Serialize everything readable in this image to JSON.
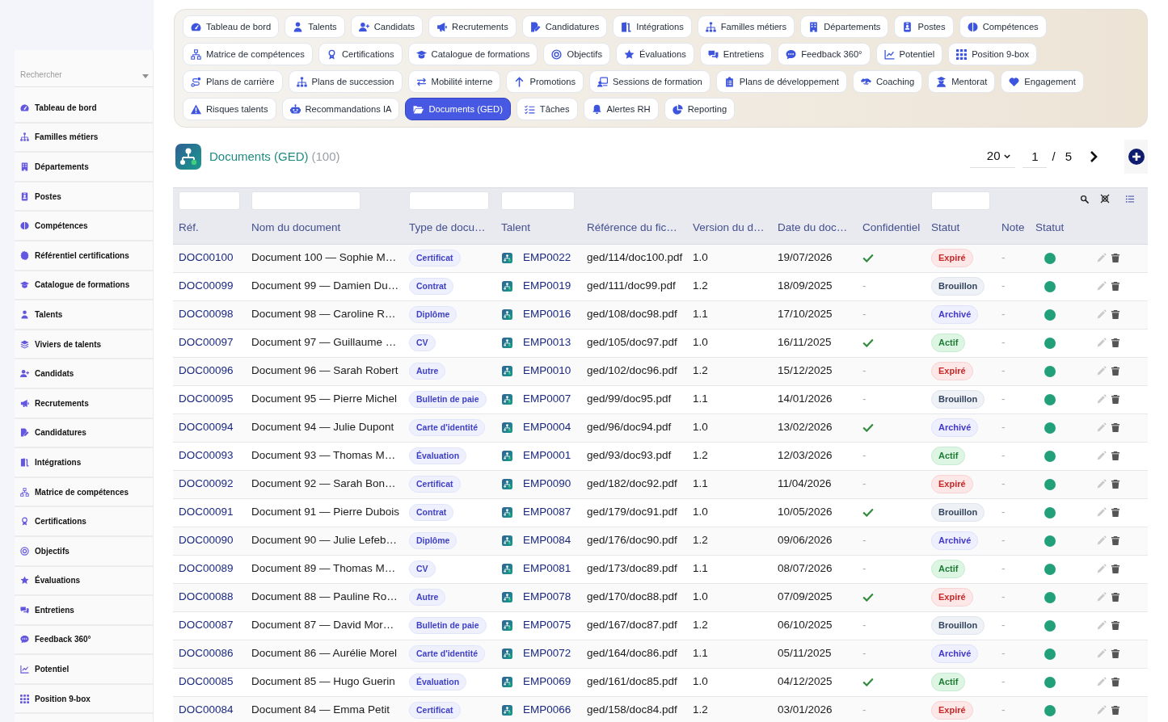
{
  "sidebar": {
    "search": {
      "placeholder": "Rechercher"
    },
    "items": [
      {
        "label": "Tableau de bord"
      },
      {
        "label": "Familles métiers"
      },
      {
        "label": "Départements"
      },
      {
        "label": "Postes"
      },
      {
        "label": "Compétences"
      },
      {
        "label": "Référentiel certifications"
      },
      {
        "label": "Catalogue de formations"
      },
      {
        "label": "Talents"
      },
      {
        "label": "Viviers de talents"
      },
      {
        "label": "Candidats"
      },
      {
        "label": "Recrutements"
      },
      {
        "label": "Candidatures"
      },
      {
        "label": "Intégrations"
      },
      {
        "label": "Matrice de compétences"
      },
      {
        "label": "Certifications"
      },
      {
        "label": "Objectifs"
      },
      {
        "label": "Évaluations"
      },
      {
        "label": "Entretiens"
      },
      {
        "label": "Feedback 360°"
      },
      {
        "label": "Potentiel"
      },
      {
        "label": "Position 9-box"
      }
    ]
  },
  "nav_tabs": [
    {
      "label": "Tableau de bord",
      "selected": false
    },
    {
      "label": "Talents",
      "selected": false
    },
    {
      "label": "Candidats",
      "selected": false
    },
    {
      "label": "Recrutements",
      "selected": false
    },
    {
      "label": "Candidatures",
      "selected": false
    },
    {
      "label": "Intégrations",
      "selected": false
    },
    {
      "label": "Familles métiers",
      "selected": false
    },
    {
      "label": "Départements",
      "selected": false
    },
    {
      "label": "Postes",
      "selected": false
    },
    {
      "label": "Compétences",
      "selected": false
    },
    {
      "label": "Matrice de compétences",
      "selected": false
    },
    {
      "label": "Certifications",
      "selected": false
    },
    {
      "label": "Catalogue de formations",
      "selected": false
    },
    {
      "label": "Objectifs",
      "selected": false
    },
    {
      "label": "Évaluations",
      "selected": false
    },
    {
      "label": "Entretiens",
      "selected": false
    },
    {
      "label": "Feedback 360°",
      "selected": false
    },
    {
      "label": "Potentiel",
      "selected": false
    },
    {
      "label": "Position 9-box",
      "selected": false
    },
    {
      "label": "Plans de carrière",
      "selected": false
    },
    {
      "label": "Plans de succession",
      "selected": false
    },
    {
      "label": "Mobilité interne",
      "selected": false
    },
    {
      "label": "Promotions",
      "selected": false
    },
    {
      "label": "Sessions de formation",
      "selected": false
    },
    {
      "label": "Plans de développement",
      "selected": false
    },
    {
      "label": "Coaching",
      "selected": false
    },
    {
      "label": "Mentorat",
      "selected": false
    },
    {
      "label": "Engagement",
      "selected": false
    },
    {
      "label": "Risques talents",
      "selected": false
    },
    {
      "label": "Recommandations IA",
      "selected": false
    },
    {
      "label": "Documents (GED)",
      "selected": true
    },
    {
      "label": "Tâches",
      "selected": false
    },
    {
      "label": "Alertes RH",
      "selected": false
    },
    {
      "label": "Reporting",
      "selected": false
    }
  ],
  "header": {
    "title": "Documents (GED)",
    "count": "(100)",
    "page_size": "20",
    "page": "1",
    "page_separator": "/",
    "page_count": "5"
  },
  "table": {
    "columns": [
      {
        "label": "Réf.",
        "filter": true
      },
      {
        "label": "Nom du document",
        "filter": true
      },
      {
        "label": "Type de docu…",
        "filter": true
      },
      {
        "label": "Talent",
        "filter": true
      },
      {
        "label": "Référence du fic…",
        "filter": false
      },
      {
        "label": "Version du d…",
        "filter": false
      },
      {
        "label": "Date du doc…",
        "filter": false
      },
      {
        "label": "Confidentiel",
        "filter": false
      },
      {
        "label": "Statut",
        "filter": true
      },
      {
        "label": "Note",
        "filter": false
      },
      {
        "label": "Statut",
        "filter": false
      }
    ],
    "rows": [
      {
        "ref": "DOC00100",
        "name": "Document 100 — Sophie M…",
        "type": "Certificat",
        "talent": "EMP0022",
        "file": "ged/114/doc100.pdf",
        "version": "1.0",
        "date": "19/07/2026",
        "confidential": true,
        "status": {
          "label": "Expiré",
          "kind": "expired"
        },
        "note": "-",
        "active": true
      },
      {
        "ref": "DOC00099",
        "name": "Document 99 — Damien Du…",
        "type": "Contrat",
        "talent": "EMP0019",
        "file": "ged/111/doc99.pdf",
        "version": "1.2",
        "date": "18/09/2025",
        "confidential": false,
        "confidential_text": "-",
        "status": {
          "label": "Brouillon",
          "kind": "draft"
        },
        "note": "-",
        "active": true
      },
      {
        "ref": "DOC00098",
        "name": "Document 98 — Caroline R…",
        "type": "Diplôme",
        "talent": "EMP0016",
        "file": "ged/108/doc98.pdf",
        "version": "1.1",
        "date": "17/10/2025",
        "confidential": false,
        "confidential_text": "-",
        "status": {
          "label": "Archivé",
          "kind": "archived"
        },
        "note": "-",
        "active": true
      },
      {
        "ref": "DOC00097",
        "name": "Document 97 — Guillaume …",
        "type": "CV",
        "talent": "EMP0013",
        "file": "ged/105/doc97.pdf",
        "version": "1.0",
        "date": "16/11/2025",
        "confidential": true,
        "status": {
          "label": "Actif",
          "kind": "active"
        },
        "note": "-",
        "active": true
      },
      {
        "ref": "DOC00096",
        "name": "Document 96 — Sarah Robert",
        "type": "Autre",
        "talent": "EMP0010",
        "file": "ged/102/doc96.pdf",
        "version": "1.2",
        "date": "15/12/2025",
        "confidential": false,
        "confidential_text": "-",
        "status": {
          "label": "Expiré",
          "kind": "expired"
        },
        "note": "-",
        "active": true
      },
      {
        "ref": "DOC00095",
        "name": "Document 95 — Pierre Michel",
        "type": "Bulletin de paie",
        "talent": "EMP0007",
        "file": "ged/99/doc95.pdf",
        "version": "1.1",
        "date": "14/01/2026",
        "confidential": false,
        "confidential_text": "-",
        "status": {
          "label": "Brouillon",
          "kind": "draft"
        },
        "note": "-",
        "active": true
      },
      {
        "ref": "DOC00094",
        "name": "Document 94 — Julie Dupont",
        "type": "Carte d'identité",
        "talent": "EMP0004",
        "file": "ged/96/doc94.pdf",
        "version": "1.0",
        "date": "13/02/2026",
        "confidential": true,
        "status": {
          "label": "Archivé",
          "kind": "archived"
        },
        "note": "-",
        "active": true
      },
      {
        "ref": "DOC00093",
        "name": "Document 93 — Thomas M…",
        "type": "Évaluation",
        "talent": "EMP0001",
        "file": "ged/93/doc93.pdf",
        "version": "1.2",
        "date": "12/03/2026",
        "confidential": false,
        "confidential_text": "-",
        "status": {
          "label": "Actif",
          "kind": "active"
        },
        "note": "-",
        "active": true
      },
      {
        "ref": "DOC00092",
        "name": "Document 92 — Sarah Bon…",
        "type": "Certificat",
        "talent": "EMP0090",
        "file": "ged/182/doc92.pdf",
        "version": "1.1",
        "date": "11/04/2026",
        "confidential": false,
        "confidential_text": "-",
        "status": {
          "label": "Expiré",
          "kind": "expired"
        },
        "note": "-",
        "active": true
      },
      {
        "ref": "DOC00091",
        "name": "Document 91 — Pierre Dubois",
        "type": "Contrat",
        "talent": "EMP0087",
        "file": "ged/179/doc91.pdf",
        "version": "1.0",
        "date": "10/05/2026",
        "confidential": true,
        "status": {
          "label": "Brouillon",
          "kind": "draft"
        },
        "note": "-",
        "active": true
      },
      {
        "ref": "DOC00090",
        "name": "Document 90 — Julie Lefeb…",
        "type": "Diplôme",
        "talent": "EMP0084",
        "file": "ged/176/doc90.pdf",
        "version": "1.2",
        "date": "09/06/2026",
        "confidential": false,
        "confidential_text": "-",
        "status": {
          "label": "Archivé",
          "kind": "archived"
        },
        "note": "-",
        "active": true
      },
      {
        "ref": "DOC00089",
        "name": "Document 89 — Thomas M…",
        "type": "CV",
        "talent": "EMP0081",
        "file": "ged/173/doc89.pdf",
        "version": "1.1",
        "date": "08/07/2026",
        "confidential": false,
        "confidential_text": "-",
        "status": {
          "label": "Actif",
          "kind": "active"
        },
        "note": "-",
        "active": true
      },
      {
        "ref": "DOC00088",
        "name": "Document 88 — Pauline Ro…",
        "type": "Autre",
        "talent": "EMP0078",
        "file": "ged/170/doc88.pdf",
        "version": "1.0",
        "date": "07/09/2025",
        "confidential": true,
        "status": {
          "label": "Expiré",
          "kind": "expired"
        },
        "note": "-",
        "active": true
      },
      {
        "ref": "DOC00087",
        "name": "Document 87 — David Mor…",
        "type": "Bulletin de paie",
        "talent": "EMP0075",
        "file": "ged/167/doc87.pdf",
        "version": "1.2",
        "date": "06/10/2025",
        "confidential": false,
        "confidential_text": "-",
        "status": {
          "label": "Brouillon",
          "kind": "draft"
        },
        "note": "-",
        "active": true
      },
      {
        "ref": "DOC00086",
        "name": "Document 86 — Aurélie Morel",
        "type": "Carte d'identité",
        "talent": "EMP0072",
        "file": "ged/164/doc86.pdf",
        "version": "1.1",
        "date": "05/11/2025",
        "confidential": false,
        "confidential_text": "-",
        "status": {
          "label": "Archivé",
          "kind": "archived"
        },
        "note": "-",
        "active": true
      },
      {
        "ref": "DOC00085",
        "name": "Document 85 — Hugo Guerin",
        "type": "Évaluation",
        "talent": "EMP0069",
        "file": "ged/161/doc85.pdf",
        "version": "1.0",
        "date": "04/12/2025",
        "confidential": true,
        "status": {
          "label": "Actif",
          "kind": "active"
        },
        "note": "-",
        "active": true
      },
      {
        "ref": "DOC00084",
        "name": "Document 84 — Emma Petit",
        "type": "Certificat",
        "talent": "EMP0066",
        "file": "ged/158/doc84.pdf",
        "version": "1.2",
        "date": "03/01/2026",
        "confidential": false,
        "confidential_text": "-",
        "status": {
          "label": "Expiré",
          "kind": "expired"
        },
        "note": "-",
        "active": true
      }
    ]
  }
}
